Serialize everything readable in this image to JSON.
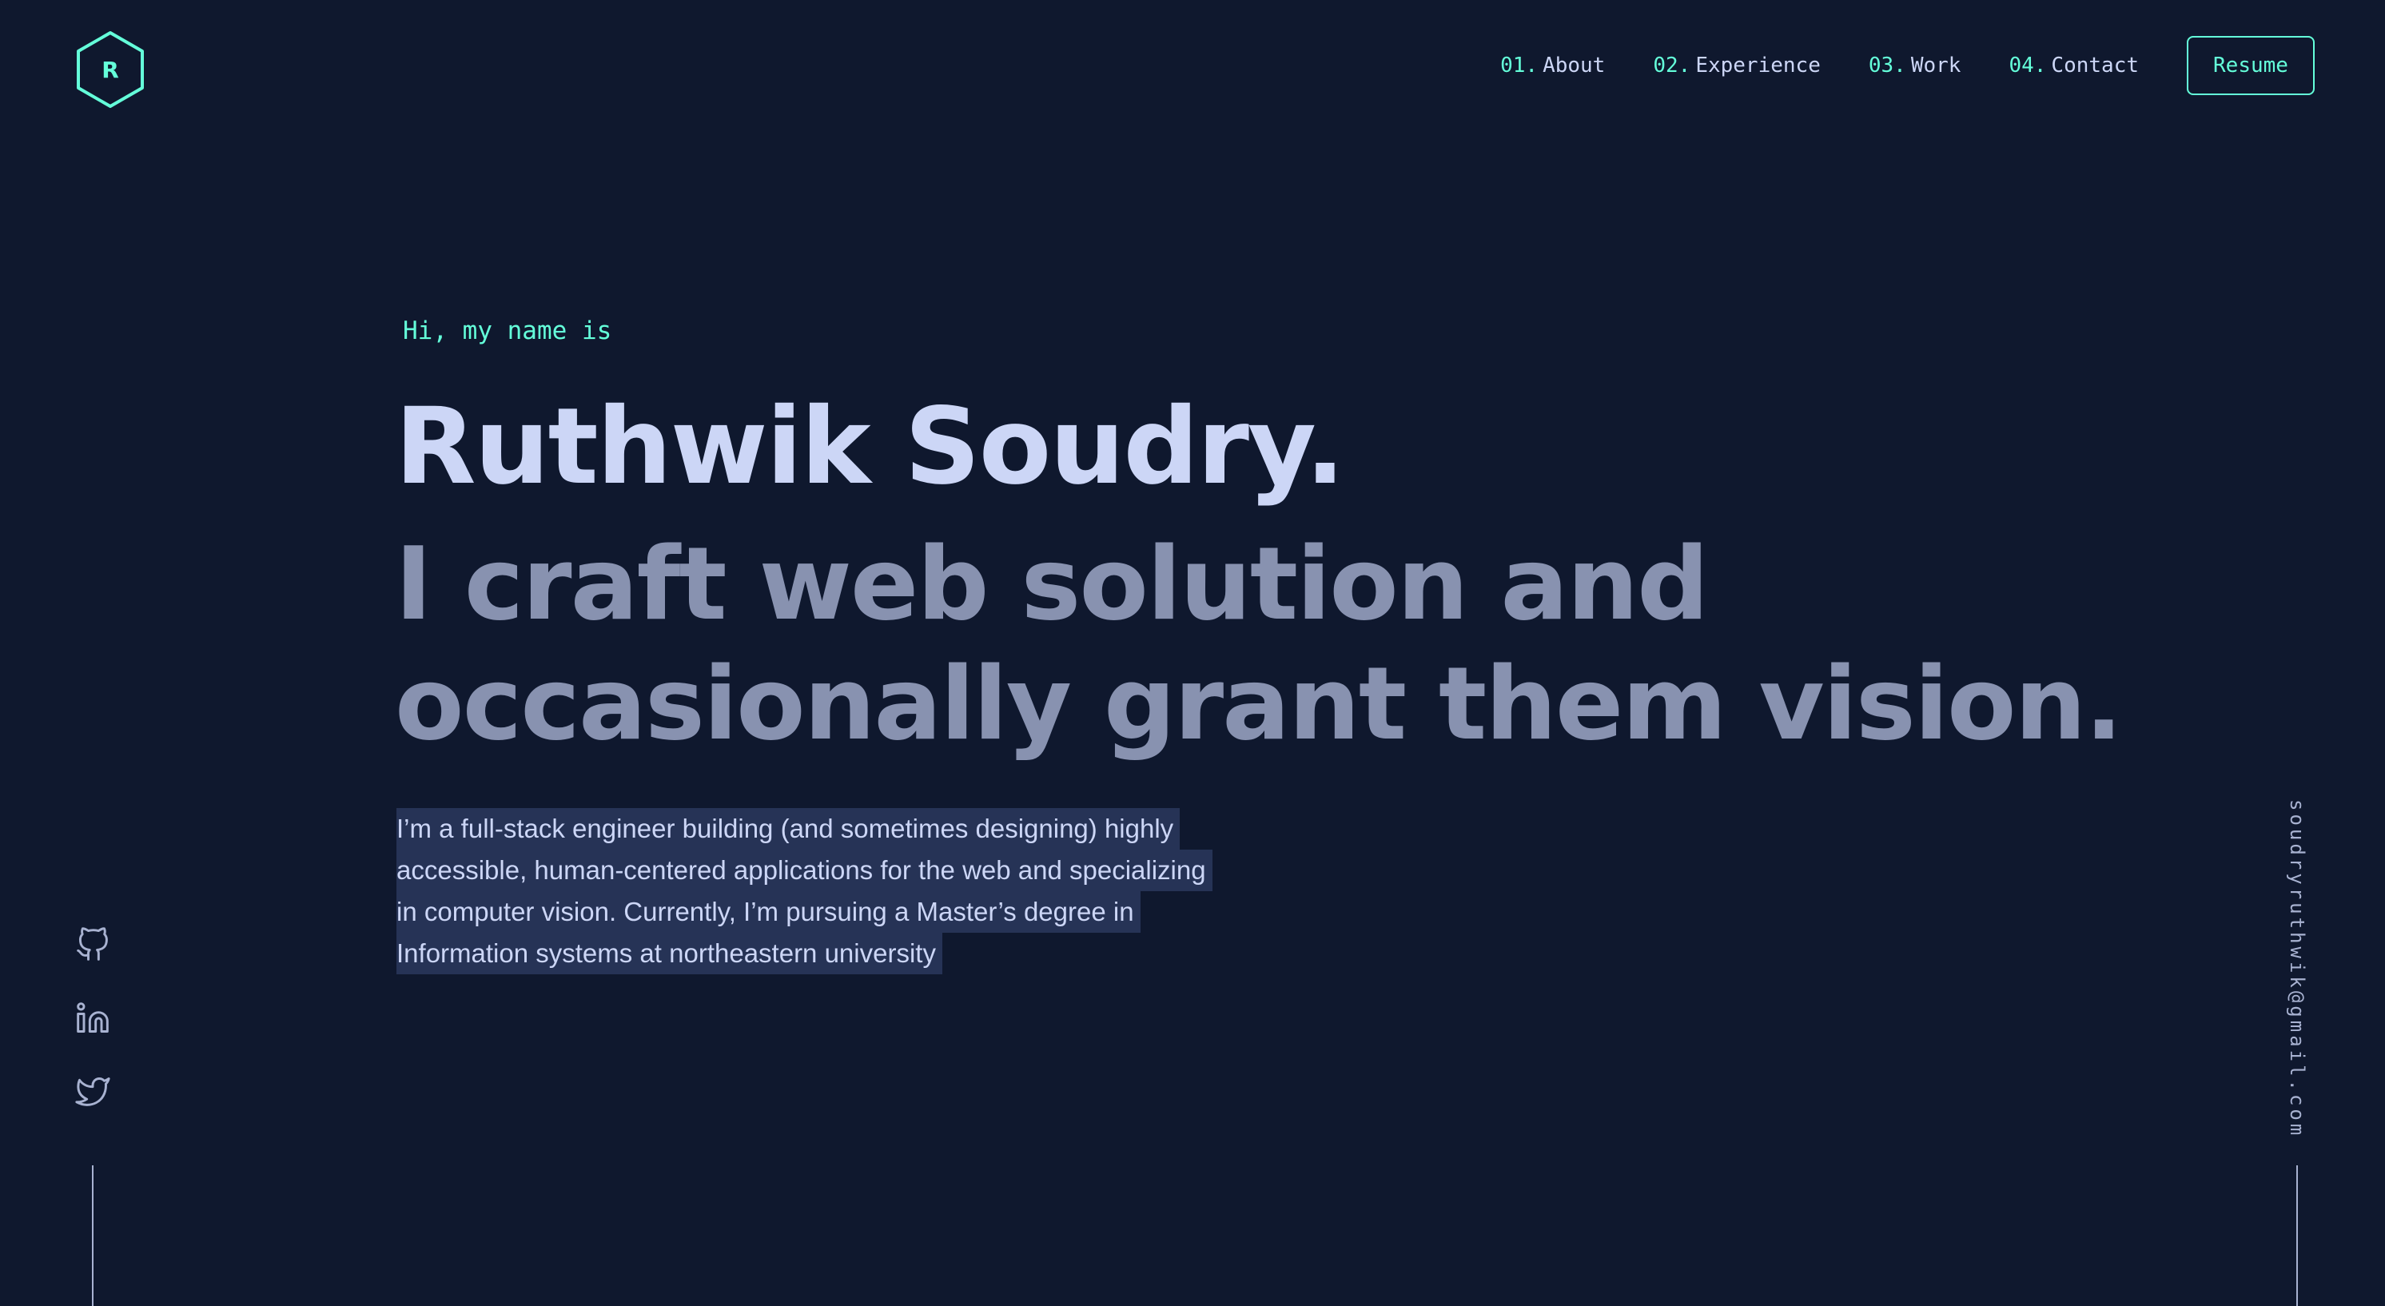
{
  "logo": {
    "letter": "R"
  },
  "nav": {
    "items": [
      {
        "num": "01.",
        "label": "About"
      },
      {
        "num": "02.",
        "label": "Experience"
      },
      {
        "num": "03.",
        "label": "Work"
      },
      {
        "num": "04.",
        "label": "Contact"
      }
    ],
    "resume_label": "Resume"
  },
  "hero": {
    "intro": "Hi, my name is",
    "name": "Ruthwik Soudry.",
    "tagline_line1": "I craft web solution and",
    "tagline_line2": "occasionally grant them vision.",
    "bio_lines": [
      "I’m a full-stack engineer building (and sometimes designing) highly",
      "accessible, human-centered applications for the web and specializing",
      "in computer vision. Currently, I’m pursuing a Master’s degree in",
      "Information systems at northeastern university"
    ]
  },
  "social": {
    "icons": [
      "github-icon",
      "linkedin-icon",
      "twitter-icon"
    ]
  },
  "contact": {
    "email": "soudryruthwik@gmail.com"
  },
  "colors": {
    "background": "#0f182e",
    "accent": "#64ffda",
    "heading": "#ccd6f6",
    "muted": "#8892b0",
    "highlight": "#263356"
  }
}
